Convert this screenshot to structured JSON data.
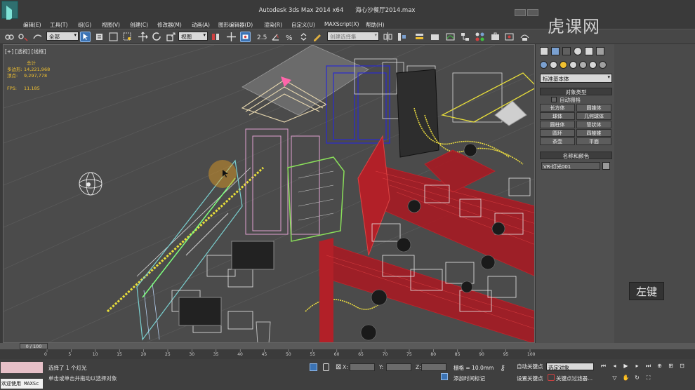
{
  "titlebar": {
    "app": "Autodesk 3ds Max  2014 x64",
    "file": "海心沙餐厅2014.max"
  },
  "menu": [
    "编辑(E)",
    "工具(T)",
    "组(G)",
    "视图(V)",
    "创建(C)",
    "修改器(M)",
    "动画(A)",
    "图形编辑器(D)",
    "渲染(R)",
    "自定义(U)",
    "MAXScript(X)",
    "帮助(H)"
  ],
  "toolbar": {
    "filter_value": "全部",
    "refcoord_value": "视图",
    "named_sel_placeholder": "创建选择集"
  },
  "viewport": {
    "label": "[+] [透视] [线框]",
    "stats_title": "总计",
    "poly_label": "多边形:",
    "poly_value": "14,221,968",
    "vert_label": "顶点:",
    "vert_value": "9,297,778",
    "fps_label": "FPS:",
    "fps_value": "11.185"
  },
  "cmdpanel": {
    "dropdown": "标准基本体",
    "object_type_header": "对象类型",
    "autogrid": "自动栅格",
    "buttons": [
      "长方体",
      "圆锥体",
      "球体",
      "几何球体",
      "圆柱体",
      "管状体",
      "圆环",
      "四棱锥",
      "茶壶",
      "平面"
    ],
    "name_color_header": "名称和颜色",
    "name_value": "VR-灯光001"
  },
  "kbd_hint": "左键",
  "watermark": "虎课网",
  "timeline": {
    "slider": "0 / 100",
    "ticks": [
      "0",
      "5",
      "10",
      "15",
      "20",
      "25",
      "30",
      "35",
      "40",
      "45",
      "50",
      "55",
      "60",
      "65",
      "70",
      "75",
      "80",
      "85",
      "90",
      "95",
      "100"
    ]
  },
  "status": {
    "maxscript_label": "欢迎使用 MAXSc",
    "line1": "选择了 1 个灯光",
    "line2": "单击或单击并拖动以选择对象",
    "x_label": "X:",
    "y_label": "Y:",
    "z_label": "Z:",
    "grid": "栅格 = 10.0mm",
    "add_time": "添加时间标记",
    "autokey": "自动关键点",
    "selection": "选定对象",
    "setkey": "设置关键点",
    "keyfilter": "关键点过滤器..."
  },
  "colors": {
    "accent": "#3b73b4",
    "stats": "#f0c030",
    "lights_red": "#c8222a",
    "lights_blue": "#2a2ad0"
  }
}
